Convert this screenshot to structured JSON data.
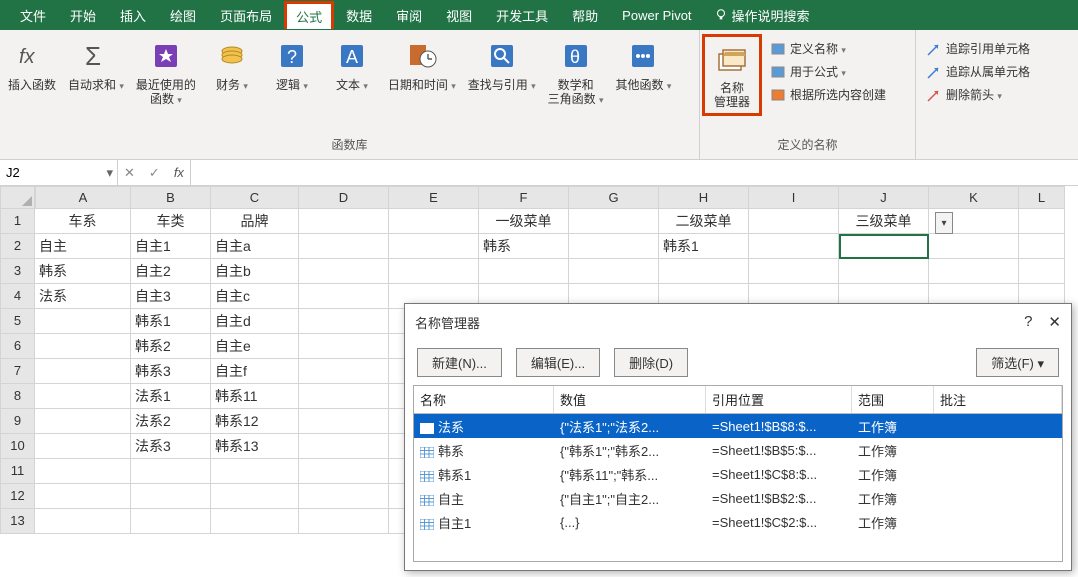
{
  "menu": {
    "tabs": [
      "文件",
      "开始",
      "插入",
      "绘图",
      "页面布局",
      "公式",
      "数据",
      "审阅",
      "视图",
      "开发工具",
      "帮助",
      "Power Pivot"
    ],
    "activeIndex": 5,
    "search": "操作说明搜索"
  },
  "ribbon": {
    "insertFn": "插入函数",
    "lib": [
      "自动求和",
      "最近使用的\n函数",
      "财务",
      "逻辑",
      "文本",
      "日期和时间",
      "查找与引用",
      "数学和\n三角函数",
      "其他函数"
    ],
    "libLabel": "函数库",
    "nameMgr": "名称\n管理器",
    "names": {
      "items": [
        "定义名称",
        "用于公式",
        "根据所选内容创建"
      ],
      "label": "定义的名称"
    },
    "audit": [
      "追踪引用单元格",
      "追踪从属单元格",
      "删除箭头"
    ]
  },
  "cellRef": "J2",
  "fx": "",
  "cols": [
    "A",
    "B",
    "C",
    "D",
    "E",
    "F",
    "G",
    "H",
    "I",
    "J",
    "K",
    "L"
  ],
  "sheet": [
    [
      "车系",
      "车类",
      "品牌",
      "",
      "",
      "一级菜单",
      "",
      "二级菜单",
      "",
      "三级菜单",
      "",
      ""
    ],
    [
      "自主",
      "自主1",
      "自主a",
      "",
      "",
      "韩系",
      "",
      "韩系1",
      "",
      "",
      "",
      ""
    ],
    [
      "韩系",
      "自主2",
      "自主b",
      "",
      "",
      "",
      "",
      "",
      "",
      "",
      "",
      ""
    ],
    [
      "法系",
      "自主3",
      "自主c",
      "",
      "",
      "",
      "",
      "",
      "",
      "",
      "",
      ""
    ],
    [
      "",
      "韩系1",
      "自主d",
      "",
      "",
      "",
      "",
      "",
      "",
      "",
      "",
      ""
    ],
    [
      "",
      "韩系2",
      "自主e",
      "",
      "",
      "",
      "",
      "",
      "",
      "",
      "",
      ""
    ],
    [
      "",
      "韩系3",
      "自主f",
      "",
      "",
      "",
      "",
      "",
      "",
      "",
      "",
      ""
    ],
    [
      "",
      "法系1",
      "韩系11",
      "",
      "",
      "",
      "",
      "",
      "",
      "",
      "",
      ""
    ],
    [
      "",
      "法系2",
      "韩系12",
      "",
      "",
      "",
      "",
      "",
      "",
      "",
      "",
      ""
    ],
    [
      "",
      "法系3",
      "韩系13",
      "",
      "",
      "",
      "",
      "",
      "",
      "",
      "",
      ""
    ],
    [
      "",
      "",
      "",
      "",
      "",
      "",
      "",
      "",
      "",
      "",
      "",
      ""
    ],
    [
      "",
      "",
      "",
      "",
      "",
      "",
      "",
      "",
      "",
      "",
      "",
      ""
    ],
    [
      "",
      "",
      "",
      "",
      "",
      "",
      "",
      "",
      "",
      "",
      "",
      ""
    ]
  ],
  "dialog": {
    "title": "名称管理器",
    "btns": {
      "new": "新建(N)...",
      "edit": "编辑(E)...",
      "del": "删除(D)",
      "filter": "筛选(F)"
    },
    "headers": [
      "名称",
      "数值",
      "引用位置",
      "范围",
      "批注"
    ],
    "rows": [
      {
        "name": "法系",
        "val": "{\"法系1\";\"法系2...",
        "ref": "=Sheet1!$B$8:$...",
        "scope": "工作簿",
        "note": ""
      },
      {
        "name": "韩系",
        "val": "{\"韩系1\";\"韩系2...",
        "ref": "=Sheet1!$B$5:$...",
        "scope": "工作簿",
        "note": ""
      },
      {
        "name": "韩系1",
        "val": "{\"韩系11\";\"韩系...",
        "ref": "=Sheet1!$C$8:$...",
        "scope": "工作簿",
        "note": ""
      },
      {
        "name": "自主",
        "val": "{\"自主1\";\"自主2...",
        "ref": "=Sheet1!$B$2:$...",
        "scope": "工作簿",
        "note": ""
      },
      {
        "name": "自主1",
        "val": "{...}",
        "ref": "=Sheet1!$C$2:$...",
        "scope": "工作簿",
        "note": ""
      }
    ],
    "selected": 0
  }
}
